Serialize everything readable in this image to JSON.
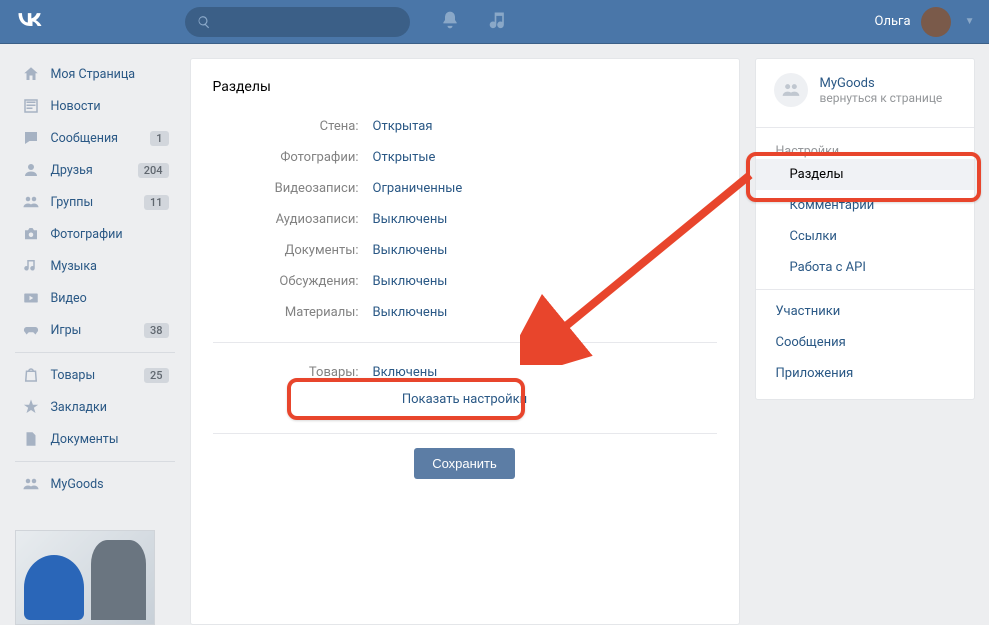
{
  "header": {
    "user_name": "Ольга",
    "search_placeholder": ""
  },
  "left_nav": {
    "items": [
      {
        "label": "Моя Страница",
        "badge": ""
      },
      {
        "label": "Новости",
        "badge": ""
      },
      {
        "label": "Сообщения",
        "badge": "1"
      },
      {
        "label": "Друзья",
        "badge": "204"
      },
      {
        "label": "Группы",
        "badge": "11"
      },
      {
        "label": "Фотографии",
        "badge": ""
      },
      {
        "label": "Музыка",
        "badge": ""
      },
      {
        "label": "Видео",
        "badge": ""
      },
      {
        "label": "Игры",
        "badge": "38"
      }
    ],
    "items2": [
      {
        "label": "Товары",
        "badge": "25"
      },
      {
        "label": "Закладки",
        "badge": ""
      },
      {
        "label": "Документы",
        "badge": ""
      }
    ],
    "items3": [
      {
        "label": "MyGoods",
        "badge": ""
      }
    ]
  },
  "main": {
    "title": "Разделы",
    "rows": [
      {
        "label": "Стена:",
        "value": "Открытая"
      },
      {
        "label": "Фотографии:",
        "value": "Открытые"
      },
      {
        "label": "Видеозаписи:",
        "value": "Ограниченные"
      },
      {
        "label": "Аудиозаписи:",
        "value": "Выключены"
      },
      {
        "label": "Документы:",
        "value": "Выключены"
      },
      {
        "label": "Обсуждения:",
        "value": "Выключены"
      },
      {
        "label": "Материалы:",
        "value": "Выключены"
      }
    ],
    "row_goods": {
      "label": "Товары:",
      "value": "Включены"
    },
    "show_settings": "Показать настройки",
    "save_btn": "Сохранить"
  },
  "right": {
    "group_title": "MyGoods",
    "group_sub": "вернуться к странице",
    "menu_group1": "Настройки",
    "menu1": [
      {
        "label": "Разделы",
        "active": true
      },
      {
        "label": "Комментарии",
        "active": false
      },
      {
        "label": "Ссылки",
        "active": false
      },
      {
        "label": "Работа с API",
        "active": false
      }
    ],
    "menu2": [
      {
        "label": "Участники"
      },
      {
        "label": "Сообщения"
      },
      {
        "label": "Приложения"
      }
    ]
  }
}
